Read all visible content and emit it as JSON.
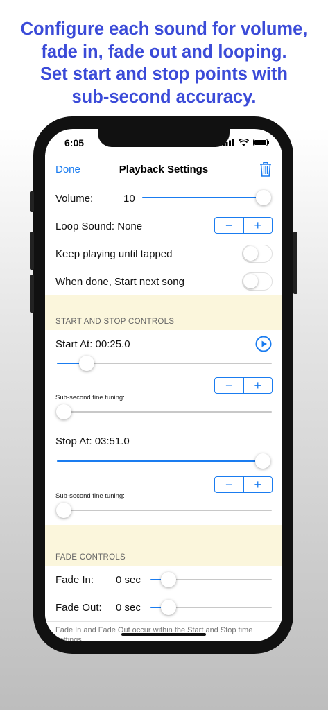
{
  "headline": {
    "line1": "Configure each sound for volume,",
    "line2": "fade in, fade out and looping.",
    "line3": "Set start and stop points with",
    "line4": "sub-second accuracy."
  },
  "status_bar": {
    "time": "6:05"
  },
  "nav": {
    "done_label": "Done",
    "title": "Playback Settings",
    "trash_icon": "trash-icon"
  },
  "volume": {
    "label": "Volume:",
    "value": "10",
    "level": 1.0
  },
  "loop": {
    "label": "Loop Sound: None",
    "minus": "−",
    "plus": "+"
  },
  "keep_playing": {
    "label": "Keep playing until tapped",
    "on": false
  },
  "start_next": {
    "label": "When done, Start next song",
    "on": false
  },
  "start_stop_section": {
    "header": "START AND STOP CONTROLS"
  },
  "start": {
    "label": "Start At: 00:25.0",
    "position": 0.14,
    "minus": "−",
    "plus": "+",
    "fine_label": "Sub-second fine tuning:",
    "fine_position": 0.0
  },
  "stop": {
    "label": "Stop At: 03:51.0",
    "position": 1.0,
    "minus": "−",
    "plus": "+",
    "fine_label": "Sub-second fine tuning:",
    "fine_position": 0.0
  },
  "fade_section": {
    "header": "FADE CONTROLS"
  },
  "fade_in": {
    "label": "Fade In:",
    "value": "0 sec",
    "position": 0.15
  },
  "fade_out": {
    "label": "Fade Out:",
    "value": "0 sec",
    "position": 0.15
  },
  "footer_note": "Fade In and Fade Out occur within the Start and Stop time settings.",
  "colors": {
    "accent": "#1a7cf0",
    "headline": "#3b4bd8",
    "section_bg": "#fbf6dc"
  }
}
